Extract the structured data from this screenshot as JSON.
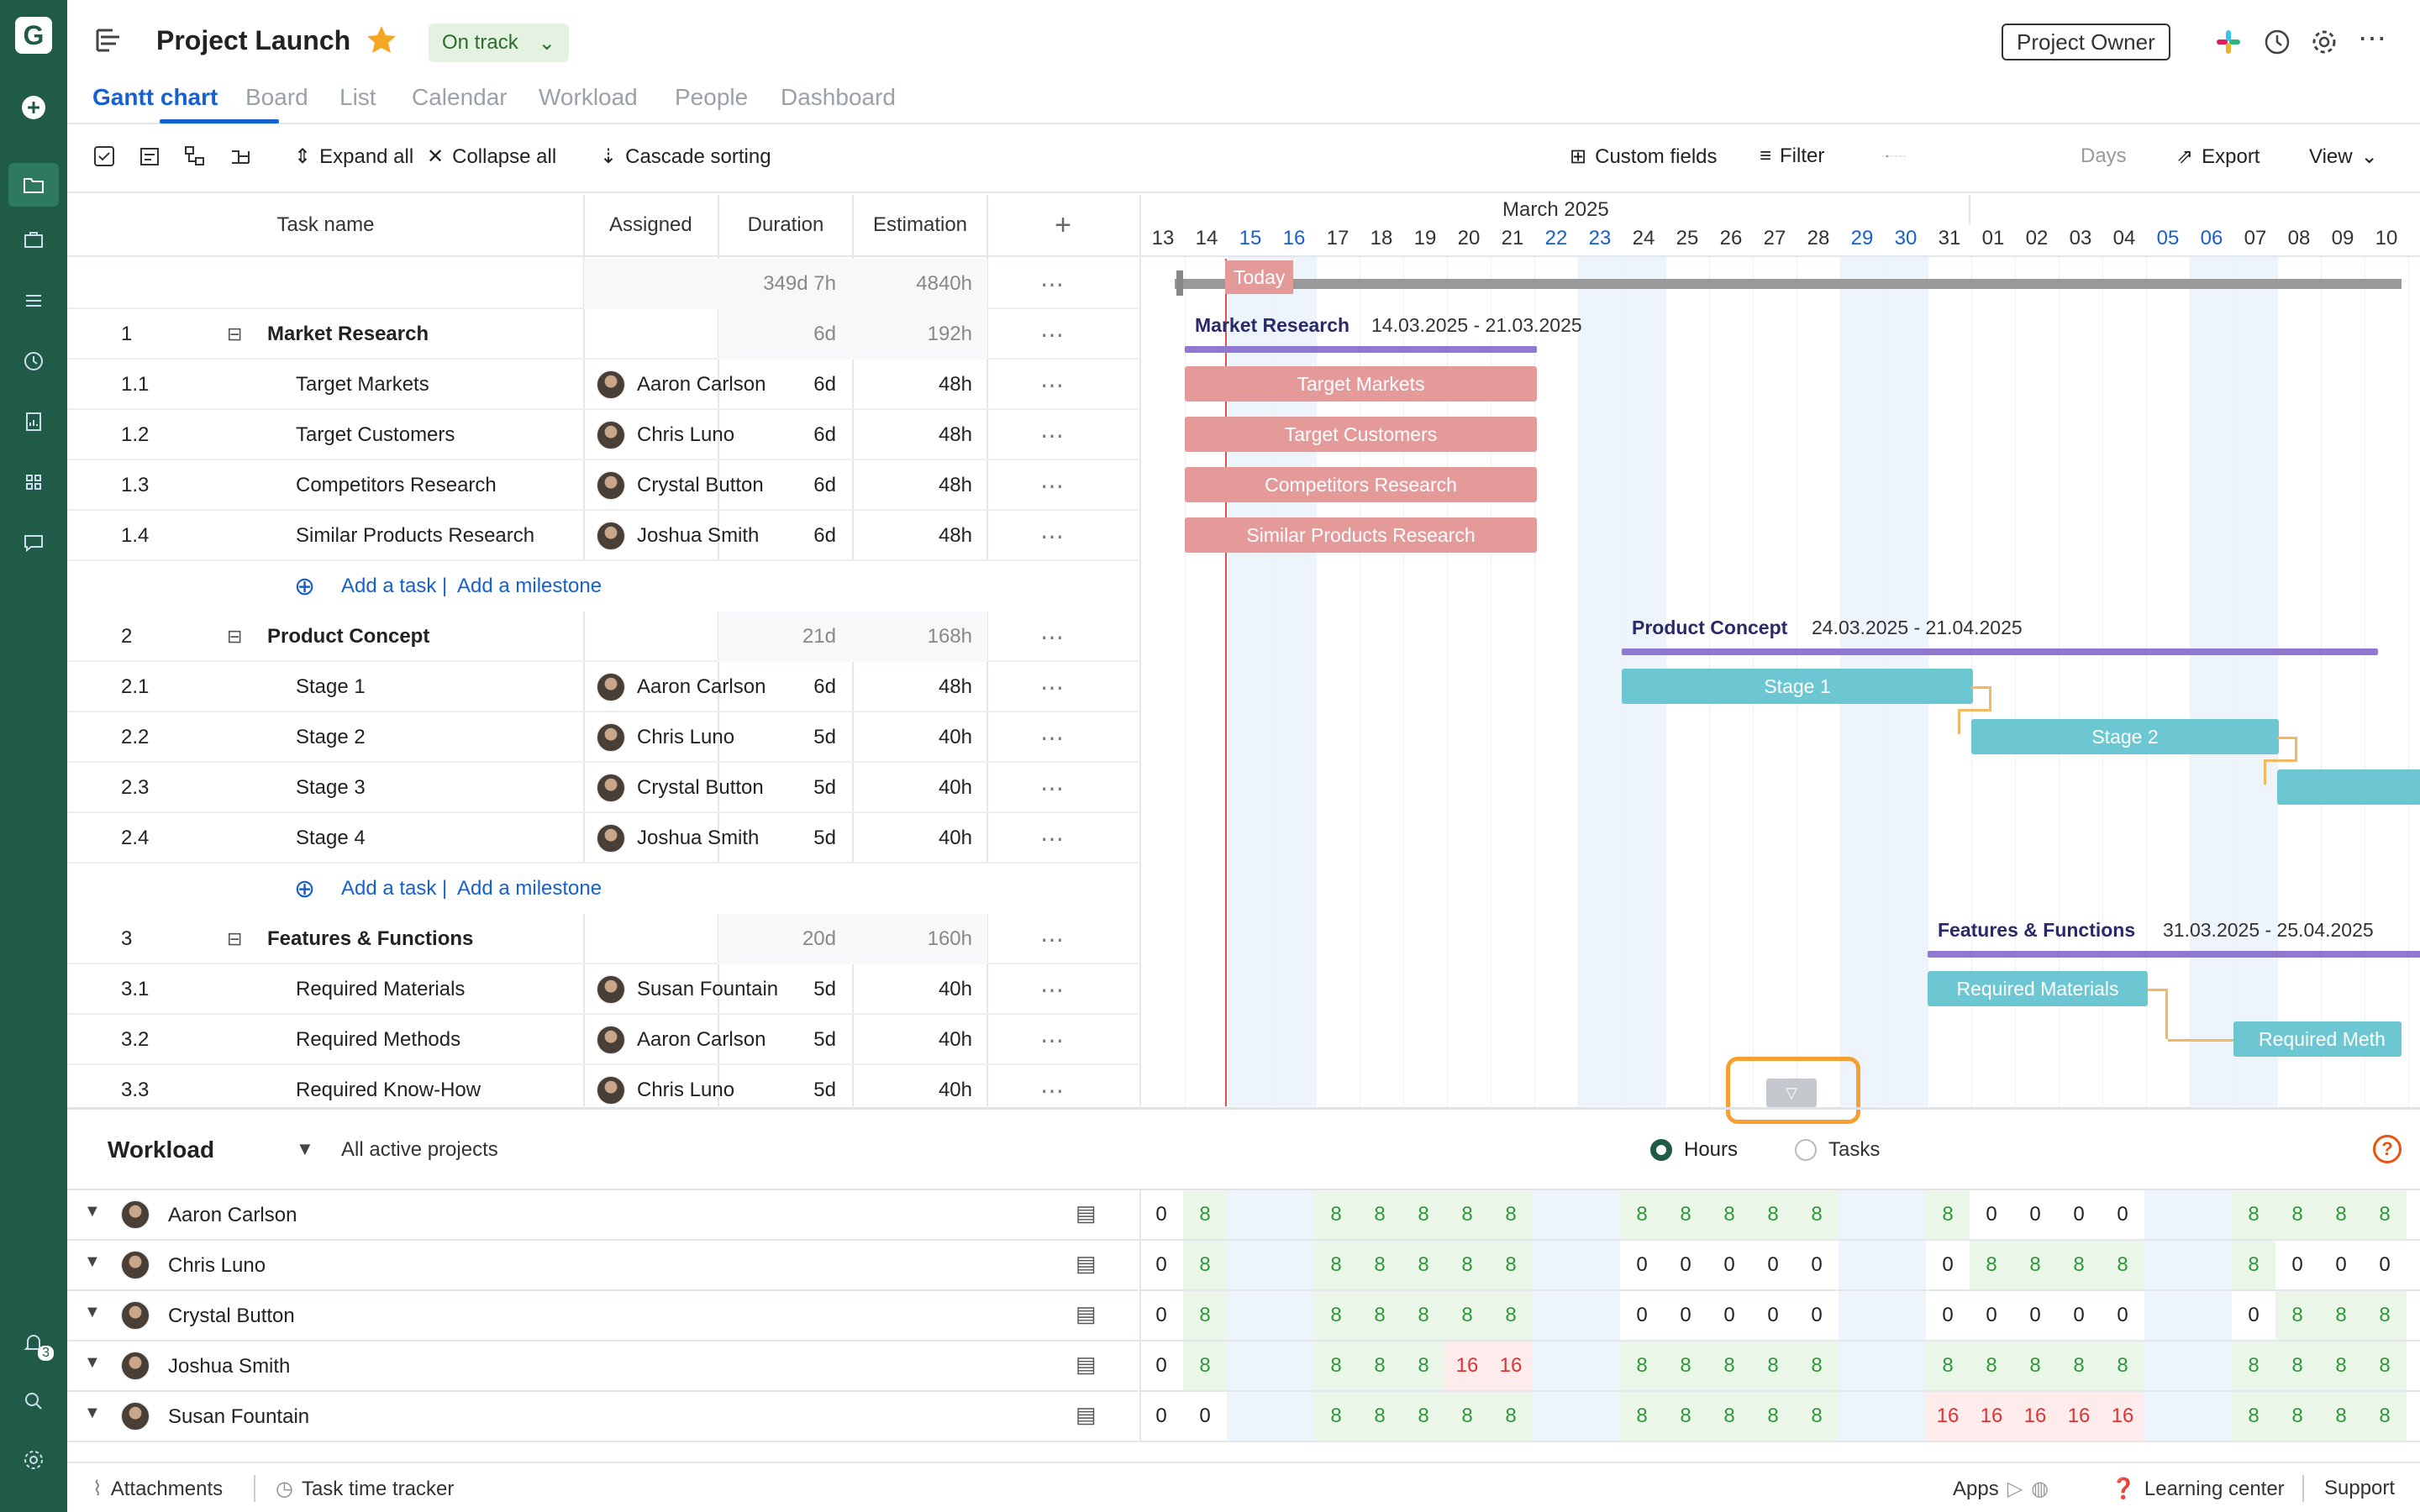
{
  "app": {
    "logo_letter": "G"
  },
  "header": {
    "title": "Project Launch",
    "status": "On track",
    "owner_button": "Project Owner"
  },
  "tabs": [
    "Gantt chart",
    "Board",
    "List",
    "Calendar",
    "Workload",
    "People",
    "Dashboard"
  ],
  "toolbar": {
    "expand_all": "Expand all",
    "collapse_all": "Collapse all",
    "cascade_sorting": "Cascade sorting",
    "custom_fields": "Custom fields",
    "filter": "Filter",
    "zoom_unit": "Days",
    "export": "Export",
    "view": "View"
  },
  "columns": {
    "task_name": "Task name",
    "assigned": "Assigned",
    "duration": "Duration",
    "estimation": "Estimation"
  },
  "totals": {
    "duration": "349d 7h",
    "estimation": "4840h"
  },
  "add_task": "Add a task",
  "add_milestone": "Add a milestone",
  "separator": "|",
  "rows": [
    {
      "id": "1",
      "name": "Market Research",
      "assigned": "",
      "duration": "6d",
      "estimation": "192h",
      "group": true
    },
    {
      "id": "1.1",
      "name": "Target Markets",
      "assigned": "Aaron Carlson",
      "duration": "6d",
      "estimation": "48h"
    },
    {
      "id": "1.2",
      "name": "Target Customers",
      "assigned": "Chris Luno",
      "duration": "6d",
      "estimation": "48h"
    },
    {
      "id": "1.3",
      "name": "Competitors Research",
      "assigned": "Crystal Button",
      "duration": "6d",
      "estimation": "48h"
    },
    {
      "id": "1.4",
      "name": "Similar Products Research",
      "assigned": "Joshua Smith",
      "duration": "6d",
      "estimation": "48h"
    },
    {
      "id": "2",
      "name": "Product Concept",
      "assigned": "",
      "duration": "21d",
      "estimation": "168h",
      "group": true
    },
    {
      "id": "2.1",
      "name": "Stage 1",
      "assigned": "Aaron Carlson",
      "duration": "6d",
      "estimation": "48h"
    },
    {
      "id": "2.2",
      "name": "Stage 2",
      "assigned": "Chris Luno",
      "duration": "5d",
      "estimation": "40h"
    },
    {
      "id": "2.3",
      "name": "Stage 3",
      "assigned": "Crystal Button",
      "duration": "5d",
      "estimation": "40h"
    },
    {
      "id": "2.4",
      "name": "Stage 4",
      "assigned": "Joshua Smith",
      "duration": "5d",
      "estimation": "40h"
    },
    {
      "id": "3",
      "name": "Features & Functions",
      "assigned": "",
      "duration": "20d",
      "estimation": "160h",
      "group": true
    },
    {
      "id": "3.1",
      "name": "Required Materials",
      "assigned": "Susan Fountain",
      "duration": "5d",
      "estimation": "40h"
    },
    {
      "id": "3.2",
      "name": "Required Methods",
      "assigned": "Aaron Carlson",
      "duration": "5d",
      "estimation": "40h"
    },
    {
      "id": "3.3",
      "name": "Required Know-How",
      "assigned": "Chris Luno",
      "duration": "5d",
      "estimation": "40h"
    }
  ],
  "timeline": {
    "month": "March 2025",
    "days": [
      "13",
      "14",
      "15",
      "16",
      "17",
      "18",
      "19",
      "20",
      "21",
      "22",
      "23",
      "24",
      "25",
      "26",
      "27",
      "28",
      "29",
      "30",
      "31",
      "01",
      "02",
      "03",
      "04",
      "05",
      "06",
      "07",
      "08",
      "09",
      "10"
    ],
    "weekends": [
      2,
      3,
      9,
      10,
      16,
      17,
      23,
      24
    ],
    "today_label": "Today"
  },
  "gantt": {
    "groups": [
      {
        "name": "Market Research",
        "range": "14.03.2025 - 21.03.2025"
      },
      {
        "name": "Product Concept",
        "range": "24.03.2025 - 21.04.2025"
      },
      {
        "name": "Features & Functions",
        "range": "31.03.2025 - 25.04.2025"
      }
    ],
    "bars": [
      "Target Markets",
      "Target Customers",
      "Competitors Research",
      "Similar Products Research",
      "Stage 1",
      "Stage 2",
      "Required Materials",
      "Required Meth"
    ]
  },
  "workload": {
    "title": "Workload",
    "scope": "All active projects",
    "mode_hours": "Hours",
    "mode_tasks": "Tasks",
    "people": [
      {
        "name": "Aaron Carlson",
        "values": [
          "0",
          "8",
          "",
          "",
          "8",
          "8",
          "8",
          "8",
          "8",
          "",
          "",
          "8",
          "8",
          "8",
          "8",
          "8",
          "",
          "",
          "8",
          "0",
          "0",
          "0",
          "0",
          "",
          "",
          "8",
          "8",
          "8",
          "8"
        ]
      },
      {
        "name": "Chris Luno",
        "values": [
          "0",
          "8",
          "",
          "",
          "8",
          "8",
          "8",
          "8",
          "8",
          "",
          "",
          "0",
          "0",
          "0",
          "0",
          "0",
          "",
          "",
          "0",
          "8",
          "8",
          "8",
          "8",
          "",
          "",
          "8",
          "0",
          "0",
          "0"
        ]
      },
      {
        "name": "Crystal Button",
        "values": [
          "0",
          "8",
          "",
          "",
          "8",
          "8",
          "8",
          "8",
          "8",
          "",
          "",
          "0",
          "0",
          "0",
          "0",
          "0",
          "",
          "",
          "0",
          "0",
          "0",
          "0",
          "0",
          "",
          "",
          "0",
          "8",
          "8",
          "8"
        ]
      },
      {
        "name": "Joshua Smith",
        "values": [
          "0",
          "8",
          "",
          "",
          "8",
          "8",
          "8",
          "16",
          "16",
          "",
          "",
          "8",
          "8",
          "8",
          "8",
          "8",
          "",
          "",
          "8",
          "8",
          "8",
          "8",
          "8",
          "",
          "",
          "8",
          "8",
          "8",
          "8"
        ]
      },
      {
        "name": "Susan Fountain",
        "values": [
          "0",
          "0",
          "",
          "",
          "8",
          "8",
          "8",
          "8",
          "8",
          "",
          "",
          "8",
          "8",
          "8",
          "8",
          "8",
          "",
          "",
          "16",
          "16",
          "16",
          "16",
          "16",
          "",
          "",
          "8",
          "8",
          "8",
          "8"
        ]
      }
    ]
  },
  "footer": {
    "attachments": "Attachments",
    "time_tracker": "Task time tracker",
    "apps": "Apps",
    "learning": "Learning center",
    "support": "Support",
    "notif_count": "3"
  },
  "colors": {
    "brand": "#1f5b47",
    "accent": "#1660d0",
    "market_bar": "#e59a9a",
    "concept_bar": "#6cc7d3",
    "group_line": "#8f78cf",
    "today": "#e05050"
  }
}
